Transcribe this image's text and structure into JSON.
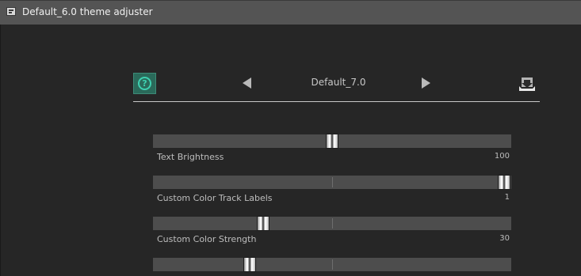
{
  "window": {
    "title": "Default_6.0 theme adjuster",
    "app_icon": "window-app-icon"
  },
  "header": {
    "help_icon": "question-circle-icon",
    "help_glyph": "?",
    "prev_icon": "triangle-left-icon",
    "next_icon": "triangle-right-icon",
    "theme_name": "Default_7.0",
    "save_icon": "download-tray-icon",
    "accent_color": "#3fd0b0"
  },
  "sliders": [
    {
      "label": "Text Brightness",
      "value": "100",
      "level": 0.5
    },
    {
      "label": "Custom Color Track Labels",
      "value": "1",
      "level": 1.0
    },
    {
      "label": "Custom Color Strength",
      "value": "30",
      "level": 0.3
    },
    {
      "label": "",
      "value": "",
      "level": 0.26
    }
  ]
}
